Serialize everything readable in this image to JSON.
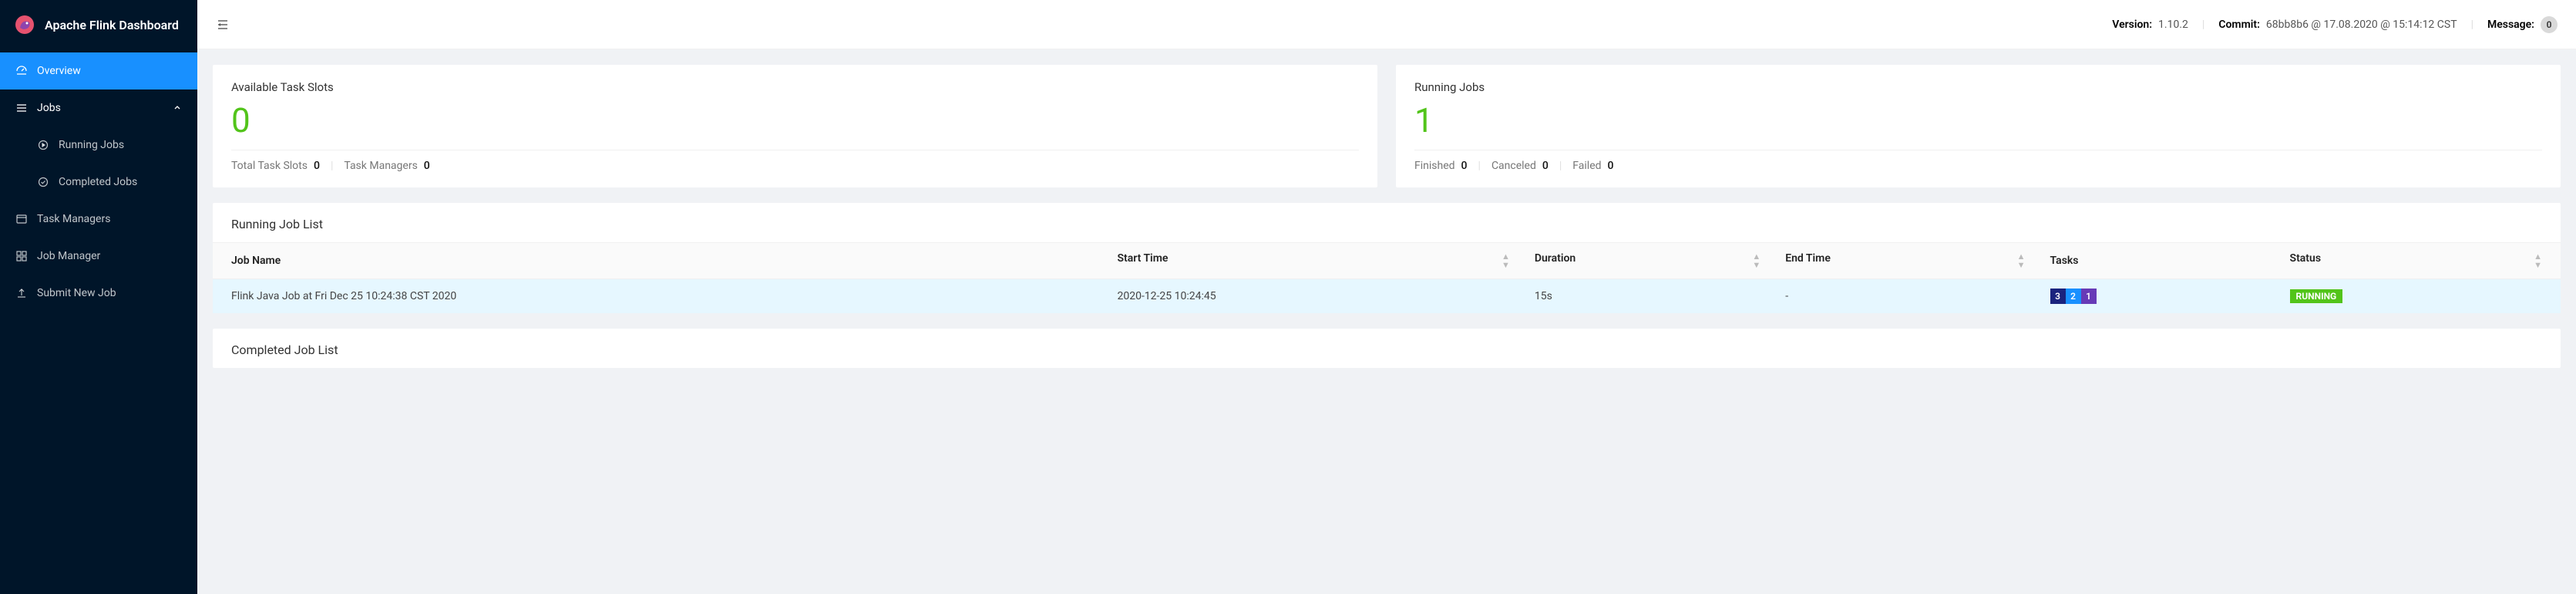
{
  "brand": {
    "title": "Apache Flink Dashboard"
  },
  "sidebar": {
    "items": [
      {
        "label": "Overview"
      },
      {
        "label": "Jobs"
      },
      {
        "label": "Running Jobs"
      },
      {
        "label": "Completed Jobs"
      },
      {
        "label": "Task Managers"
      },
      {
        "label": "Job Manager"
      },
      {
        "label": "Submit New Job"
      }
    ]
  },
  "header": {
    "version_label": "Version:",
    "version_value": "1.10.2",
    "commit_label": "Commit:",
    "commit_value": "68bb8b6 @ 17.08.2020 @ 15:14:12 CST",
    "message_label": "Message:",
    "message_count": "0"
  },
  "stats": {
    "slots": {
      "title": "Available Task Slots",
      "value": "0",
      "total_label": "Total Task Slots",
      "total_value": "0",
      "tm_label": "Task Managers",
      "tm_value": "0"
    },
    "jobs": {
      "title": "Running Jobs",
      "value": "1",
      "finished_label": "Finished",
      "finished_value": "0",
      "canceled_label": "Canceled",
      "canceled_value": "0",
      "failed_label": "Failed",
      "failed_value": "0"
    }
  },
  "running_list": {
    "title": "Running Job List",
    "columns": {
      "job_name": "Job Name",
      "start_time": "Start Time",
      "duration": "Duration",
      "end_time": "End Time",
      "tasks": "Tasks",
      "status": "Status"
    },
    "rows": [
      {
        "job_name": "Flink Java Job at Fri Dec 25 10:24:38 CST 2020",
        "start_time": "2020-12-25 10:24:45",
        "duration": "15s",
        "end_time": "-",
        "tasks": [
          "3",
          "2",
          "1"
        ],
        "status": "RUNNING"
      }
    ]
  },
  "completed_list": {
    "title": "Completed Job List"
  }
}
